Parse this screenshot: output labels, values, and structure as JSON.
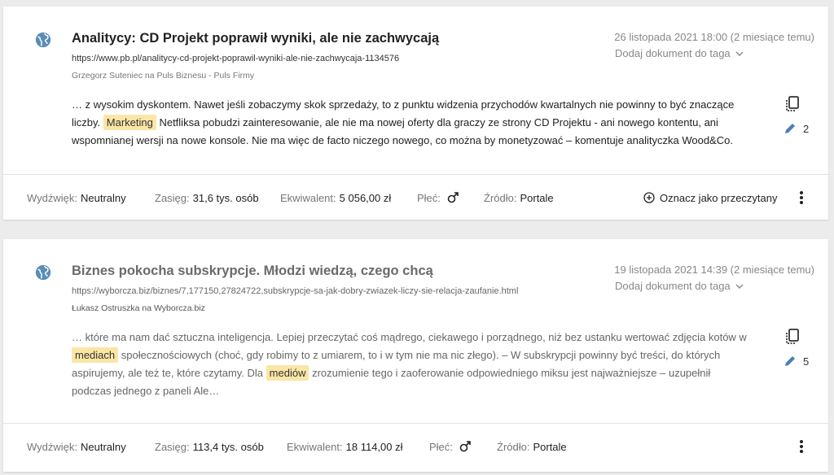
{
  "articles": [
    {
      "title": "Analitycy: CD Projekt poprawił wyniki, ale nie zachwycają",
      "url": "https://www.pb.pl/analitycy-cd-projekt-poprawil-wyniki-ale-nie-zachwycaja-1134576",
      "author": "Grzegorz Suteniec na Puls Biznesu - Puls Firmy",
      "date": "26 listopada 2021 18:00 (2 miesiące temu)",
      "tag_action": "Dodaj dokument do taga",
      "excerpt": {
        "p1": "… z wysokim dyskontem. Nawet jeśli zobaczymy skok sprzedaży, to z punktu widzenia przychodów kwartalnych nie powinny to być znaczące liczby. ",
        "h1": "Marketing",
        "p2": " Netfliksa pobudzi zainteresowanie, ale nie ma nowej oferty dla graczy ze strony CD Projektu - ani nowego kontentu, ani wspomnianej wersji na nowe konsole. Nie ma więc de facto niczego nowego, co można by monetyzować – komentuje analityczka Wood&Co."
      },
      "edit_count": "2",
      "footer": {
        "sentiment_label": "Wydźwięk:",
        "sentiment": "Neutralny",
        "reach_label": "Zasięg:",
        "reach": "31,6 tys. osób",
        "equiv_label": "Ekwiwalent:",
        "equiv": "5 056,00 zł",
        "gender_label": "Płeć:",
        "source_label": "Źródło:",
        "source": "Portale",
        "mark_read": "Oznacz jako przeczytany"
      }
    },
    {
      "title": "Biznes pokocha subskrypcje. Młodzi wiedzą, czego chcą",
      "url": "https://wyborcza.biz/biznes/7,177150,27824722,subskrypcje-sa-jak-dobry-zwiazek-liczy-sie-relacja-zaufanie.html",
      "author": "Łukasz Ostruszka na Wyborcza.biz",
      "date": "19 listopada 2021 14:39 (2 miesiące temu)",
      "tag_action": "Dodaj dokument do taga",
      "excerpt": {
        "p1": "… które ma nam dać sztuczna inteligencja. Lepiej przeczytać coś mądrego, ciekawego i porządnego, niż bez ustanku wertować zdjęcia kotów w ",
        "h1": "mediach",
        "p2": " społecznościowych (choć, gdy robimy to z umiarem, to i w tym nie ma nic złego). – W subskrypcji powinny być treści, do których aspirujemy, ale też te, które czytamy. Dla ",
        "h2": "mediów",
        "p3": " zrozumienie tego i zaoferowanie odpowiedniego miksu jest najważniejsze – uzupełnił podczas jednego z paneli Ale…"
      },
      "edit_count": "5",
      "footer": {
        "sentiment_label": "Wydźwięk:",
        "sentiment": "Neutralny",
        "reach_label": "Zasięg:",
        "reach": "113,4 tys. osób",
        "equiv_label": "Ekwiwalent:",
        "equiv": "18 114,00 zł",
        "gender_label": "Płeć:",
        "source_label": "Źródło:",
        "source": "Portale"
      }
    }
  ],
  "colors": {
    "globe": "#5a8db8",
    "highlight": "#fbe6a6",
    "edit_icon": "#4a7fb5"
  },
  "icons": [
    "globe-icon",
    "chevron-down-icon",
    "copy-icon",
    "pencil-icon",
    "male-icon",
    "plus-circle-icon",
    "kebab-menu-icon"
  ]
}
